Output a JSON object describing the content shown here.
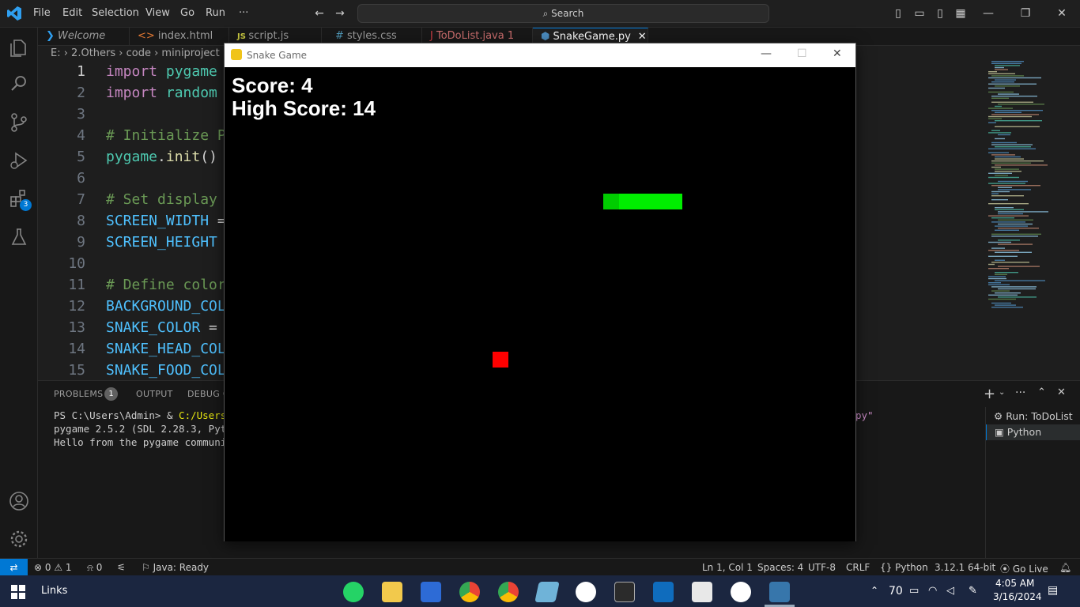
{
  "menu": [
    "File",
    "Edit",
    "Selection",
    "View",
    "Go",
    "Run",
    "···"
  ],
  "search": {
    "label": "Search"
  },
  "tabs": [
    {
      "label": "Welcome",
      "icon": "vscode-icon",
      "italic": true
    },
    {
      "label": "index.html",
      "icon": "html-icon"
    },
    {
      "label": "script.js",
      "icon": "js-icon"
    },
    {
      "label": "styles.css",
      "icon": "css-icon"
    },
    {
      "label": "ToDoList.java 1",
      "icon": "java-icon"
    },
    {
      "label": "SnakeGame.py",
      "icon": "python-icon",
      "active": true
    }
  ],
  "breadcrumb": "E: › 2.Others › code › miniproject › S",
  "code_lines": [
    {
      "n": "1",
      "html": "import pygame"
    },
    {
      "n": "2",
      "html": "import random"
    },
    {
      "n": "3",
      "html": ""
    },
    {
      "n": "4",
      "html": "# Initialize P"
    },
    {
      "n": "5",
      "html": "pygame.init()"
    },
    {
      "n": "6",
      "html": ""
    },
    {
      "n": "7",
      "html": "# Set display"
    },
    {
      "n": "8",
      "html": "SCREEN_WIDTH ="
    },
    {
      "n": "9",
      "html": "SCREEN_HEIGHT"
    },
    {
      "n": "10",
      "html": ""
    },
    {
      "n": "11",
      "html": "# Define color"
    },
    {
      "n": "12",
      "html": "BACKGROUND_COL"
    },
    {
      "n": "13",
      "html": "SNAKE_COLOR ="
    },
    {
      "n": "14",
      "html": "SNAKE_HEAD_COL"
    },
    {
      "n": "15",
      "html": "SNAKE_FOOD_COL"
    }
  ],
  "panel": {
    "problems": "PROBLEMS",
    "problems_count": "1",
    "output": "OUTPUT",
    "debug": "DEBUG C",
    "term_line1_prompt": "PS C:\\Users\\Admin> & ",
    "term_line1_cmd": "C:/Users/A",
    "term_line1_tail": "py\"",
    "term_line2": "pygame 2.5.2 (SDL 2.28.3, Pytho",
    "term_line3": "Hello from the pygame community",
    "terminals": [
      "Run: ToDoList",
      "Python"
    ]
  },
  "game": {
    "title": "Snake Game",
    "score": "Score: 4",
    "high_score": "High Score: 14",
    "colors": {
      "snake_head": "#00cc00",
      "snake_body": "#00ee00",
      "food": "#ff0000"
    }
  },
  "status": {
    "errors": "0",
    "warnings": "1",
    "ports": "0",
    "java": "Java: Ready",
    "position": "Ln 1, Col 1",
    "spaces": "Spaces: 4",
    "encoding": "UTF-8",
    "eol": "CRLF",
    "language": "Python",
    "interpreter": "3.12.1 64-bit",
    "golive": "Go Live"
  },
  "taskbar": {
    "links": "Links",
    "temp": "70",
    "time": "4:05 AM",
    "date": "3/16/2024"
  },
  "extensions_badge": "3"
}
